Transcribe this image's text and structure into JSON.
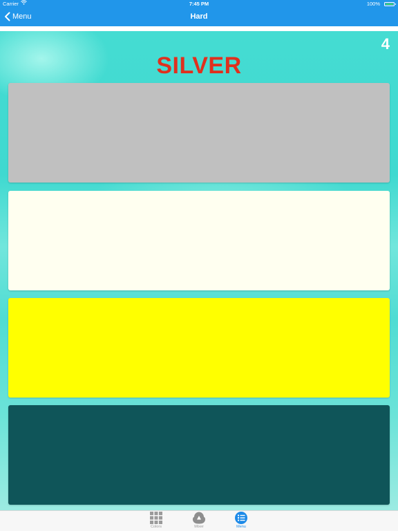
{
  "status": {
    "carrier": "Carrier",
    "time": "7:45 PM",
    "battery": "100%"
  },
  "nav": {
    "back_label": "Menu",
    "title": "Hard"
  },
  "game": {
    "score": "4",
    "word": "SILVER",
    "word_color": "#e0301e",
    "swatches": [
      {
        "color": "#c0c0c0"
      },
      {
        "color": "#fffff0"
      },
      {
        "color": "#ffff00"
      },
      {
        "color": "#0f5559"
      }
    ]
  },
  "tabs": [
    {
      "label": "Colors",
      "icon": "grid-icon",
      "active": false
    },
    {
      "label": "Mixer",
      "icon": "mixer-icon",
      "active": false
    },
    {
      "label": "Menu",
      "icon": "menu-list-icon",
      "active": true
    }
  ],
  "colors": {
    "bar": "#2196ea",
    "tab_active": "#1d8ae8",
    "tab_inactive": "#9a9a9a"
  }
}
